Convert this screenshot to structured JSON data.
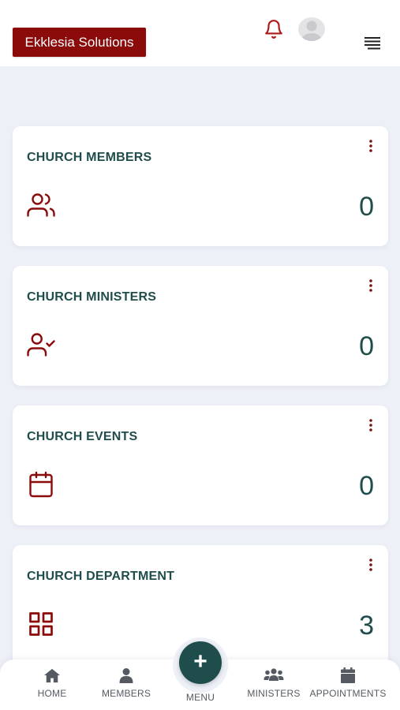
{
  "brand": {
    "label": "Ekklesia Solutions"
  },
  "colors": {
    "brand": "#8b0a0a",
    "accent": "#1f4d4b",
    "background": "#eef0f8"
  },
  "header": {
    "notification_icon": "bell-icon",
    "avatar_icon": "user-avatar",
    "menu_icon": "hamburger-icon"
  },
  "cards": [
    {
      "title": "CHURCH MEMBERS",
      "count": "0",
      "icon": "users-icon"
    },
    {
      "title": "CHURCH MINISTERS",
      "count": "0",
      "icon": "user-check-icon"
    },
    {
      "title": "CHURCH EVENTS",
      "count": "0",
      "icon": "calendar-icon"
    },
    {
      "title": "CHURCH DEPARTMENT",
      "count": "3",
      "icon": "grid-icon"
    }
  ],
  "bottom_nav": {
    "items": [
      {
        "label": "HOME",
        "icon": "home-icon"
      },
      {
        "label": "MEMBERS",
        "icon": "person-icon"
      },
      {
        "label": "MINISTERS",
        "icon": "group-icon"
      },
      {
        "label": "APPOINTMENTS",
        "icon": "calendar-icon"
      }
    ],
    "menu": {
      "label": "MENU",
      "symbol": "+"
    }
  }
}
